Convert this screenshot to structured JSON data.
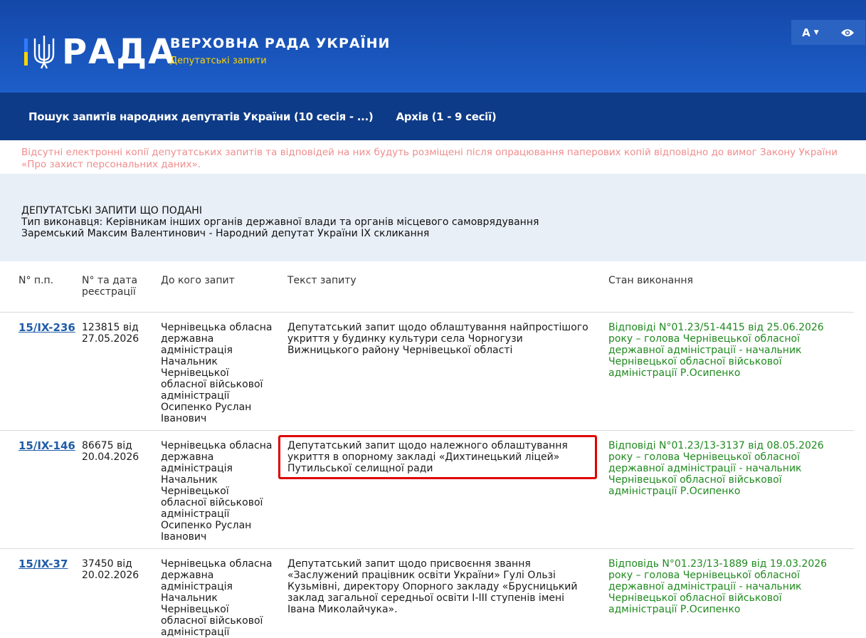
{
  "header": {
    "logo_text": "РАДА",
    "site_title": "ВЕРХОВНА РАДА УКРАЇНИ",
    "site_subtitle": "Депутатські запити",
    "tools": {
      "font_label": "А",
      "eye_icon": "eye-icon"
    },
    "colors": {
      "primary": "#1d5ec9",
      "nav": "#0e3b87",
      "accent": "#ffd500"
    }
  },
  "nav": {
    "items": [
      {
        "label": "Пошук запитів народних депутатів України (10 сесія - ...)"
      },
      {
        "label": "Архів (1 - 9 сесії)"
      }
    ]
  },
  "notice": "Відсутні електронні копії депутатських запитів та відповідей на них будуть розміщені після опрацювання паперових копій відповідно до вимог Закону України «Про захист персональних даних».",
  "info": {
    "line1": "ДЕПУТАТСЬКІ ЗАПИТИ ЩО ПОДАНІ",
    "line2": "Тип виконавця: Керівникам інших органів державної влади та органів місцевого самоврядування",
    "line3": "Заремський Максим Валентинович - Народний депутат України IX скликання"
  },
  "table": {
    "columns": [
      "N° п.п.",
      "N° та дата реєстрації",
      "До кого запит",
      "Текст запиту",
      "Стан виконання"
    ],
    "rows": [
      {
        "num": "15/IX-236",
        "reg": "123815 від 27.05.2026",
        "recipient": "Чернівецька обласна державна адміністрація Начальник Чернівецької обласної військової адміністрації Осипенко Руслан Іванович",
        "text": "Депутатський запит щодо облаштування найпростішого укриття у будинку культури села Чорногузи Вижницького району Чернівецької області",
        "status": "Відповіді N°01.23/51-4415 від 25.06.2026 року – голова Чернівецької обласної державної адміністрації - начальник Чернівецької обласної військової адміністрації Р.Осипенко"
      },
      {
        "num": "15/IX-146",
        "reg": "86675 від 20.04.2026",
        "recipient": "Чернівецька обласна державна адміністрація Начальник Чернівецької обласної військової адміністрації Осипенко Руслан Іванович",
        "text": "Депутатський запит щодо належного облаштування укриття в опорному закладі «Дихтинецький ліцей» Путильської селищної ради",
        "status": "Відповіді N°01.23/13-3137 від 08.05.2026 року – голова Чернівецької обласної державної адміністрації - начальник Чернівецької обласної військової адміністрації Р.Осипенко"
      },
      {
        "num": "15/IX-37",
        "reg": "37450 від 20.02.2026",
        "recipient": "Чернівецька обласна державна адміністрація Начальник Чернівецької обласної військової адміністрації",
        "text": "Депутатський запит щодо присвоєння звання «Заслужений працівник освіти України» Гулі Ользі Кузьмівні, директору Опорного закладу «Брусницький заклад загальної середньої освіти І-ІІІ ступенів імені Івана Миколайчука».",
        "status": "Відповідь N°01.23/13-1889 від 19.03.2026 року – голова Чернівецької обласної державної адміністрації - начальник Чернівецької обласної військової адміністрації Р.Осипенко"
      }
    ]
  }
}
